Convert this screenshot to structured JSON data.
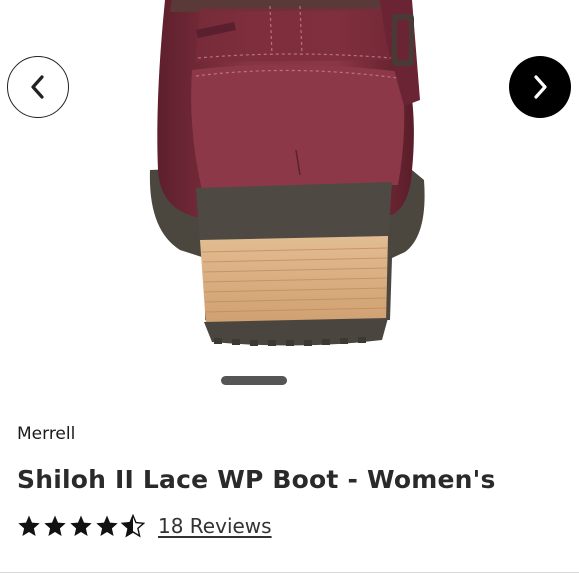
{
  "product": {
    "brand": "Merrell",
    "name": "Shiloh II Lace WP Boot - Women's",
    "rating": 4.5,
    "rating_max": 5,
    "reviews_label": "18 Reviews"
  },
  "gallery": {
    "image_name": "boot-heel-image",
    "indicator_index": 0
  },
  "icons": {
    "prev": "chevron-left-icon",
    "next": "chevron-right-icon",
    "star": "star-icon"
  },
  "colors": {
    "boot_leather": "#7a2d3c",
    "heel_wood": "#d9b187",
    "sole": "#4a4740",
    "next_button": "#000000"
  }
}
